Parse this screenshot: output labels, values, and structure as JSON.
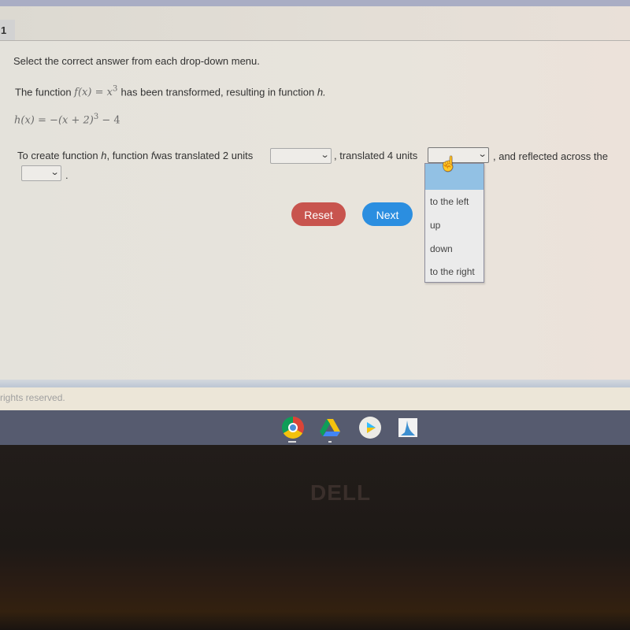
{
  "question": {
    "number": "1",
    "instruction": "Select the correct answer from each drop-down menu.",
    "line1_prefix": "The function",
    "f_def": {
      "lhs": "f(x)",
      "eq": "=",
      "rhs": "x",
      "exp": "3"
    },
    "line1_suffix": "has been transformed, resulting in function",
    "line1_end_var": "h.",
    "h_def": {
      "lhs": "h(x)",
      "eq": "=",
      "rhs_a": "−(x + 2)",
      "exp": "3",
      "rhs_b": " − 4"
    },
    "sentence": {
      "part1": "To create function ",
      "h_var": "h",
      "part2": ", function ",
      "f_var": "f",
      "part3": "was translated 2 units",
      "part4": ", translated 4 units",
      "part5": ", and reflected across the",
      "end": "."
    },
    "dropdowns": [
      {
        "selected": "",
        "chevron": "⌄"
      },
      {
        "selected": "",
        "chevron": "⌄",
        "open": true,
        "options": [
          "",
          "to the left",
          "up",
          "down",
          "to the right"
        ],
        "highlighted_index": 0
      },
      {
        "selected": "",
        "chevron": "⌄"
      }
    ]
  },
  "buttons": {
    "reset": "Reset",
    "next": "Next"
  },
  "footer": {
    "text": "rights reserved."
  },
  "shelf": {
    "apps": [
      "chrome-icon",
      "google-drive-icon",
      "play-store-icon",
      "app-icon"
    ]
  },
  "bezel": {
    "brand": "DELL"
  },
  "colors": {
    "reset": "#c8544e",
    "next": "#2b8ee0",
    "dropdown_highlight": "#92c1e4",
    "shelf": "#565b6f"
  }
}
